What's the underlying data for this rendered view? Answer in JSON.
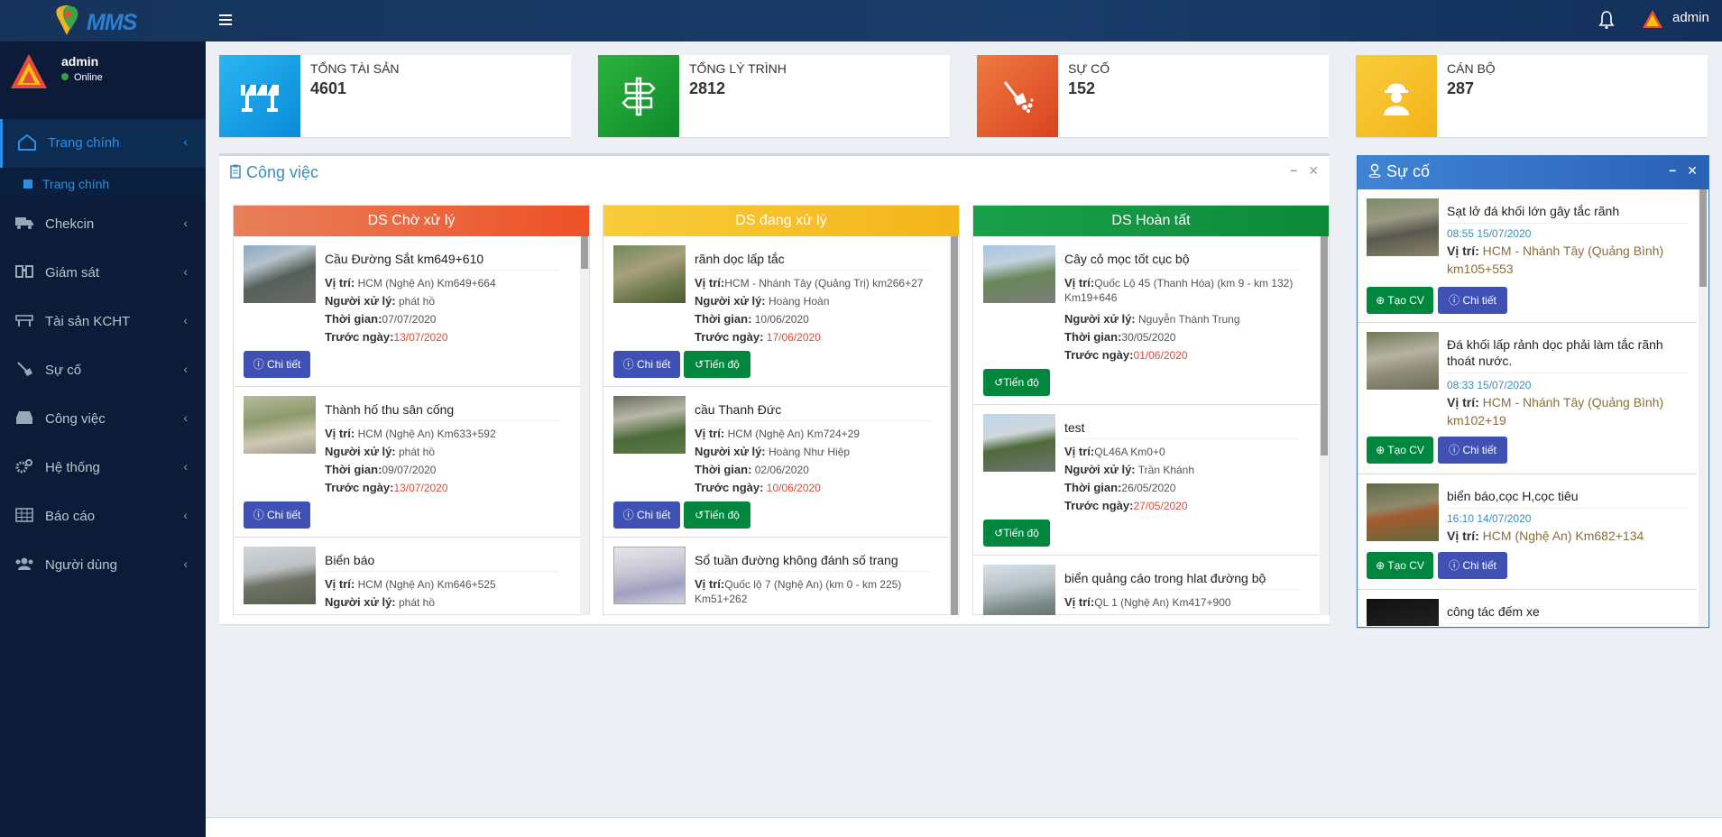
{
  "app": {
    "logo_text": "MMS"
  },
  "topbar": {
    "user": "admin"
  },
  "sidebar": {
    "user_name": "admin",
    "status": "Online",
    "items": [
      {
        "label": "Trang chính",
        "icon": "home-icon"
      },
      {
        "label": "Chekcin",
        "icon": "truck-icon"
      },
      {
        "label": "Giám sát",
        "icon": "binoculars-icon"
      },
      {
        "label": "Tài sản KCHT",
        "icon": "barrier-icon"
      },
      {
        "label": "Sự cố",
        "icon": "shovel-icon"
      },
      {
        "label": "Công việc",
        "icon": "inbox-icon"
      },
      {
        "label": "Hệ thống",
        "icon": "gears-icon"
      },
      {
        "label": "Báo cáo",
        "icon": "table-icon"
      },
      {
        "label": "Người dùng",
        "icon": "users-icon"
      }
    ],
    "subitem": "Trang chính"
  },
  "stats": [
    {
      "label": "TỔNG TÀI SẢN",
      "value": "4601",
      "color": "#0ea5e9"
    },
    {
      "label": "TỔNG LÝ TRÌNH",
      "value": "2812",
      "color": "#1aa32a"
    },
    {
      "label": "SỰ CỐ",
      "value": "152",
      "color": "#e95b2e"
    },
    {
      "label": "CÁN BỘ",
      "value": "287",
      "color": "#f8c02c"
    }
  ],
  "work": {
    "title": "Công việc",
    "labels": {
      "location": "Vị trí:",
      "handler": "Người xử lý:",
      "time": "Thời gian:",
      "due": "Trước ngày:",
      "detail": "Chi tiết",
      "progress": "Tiến độ"
    },
    "columns": [
      {
        "title": "DS Chờ xử lý",
        "items": [
          {
            "title": "Cầu Đường Sắt km649+610",
            "location": "HCM (Nghệ An) Km649+664",
            "handler": "phát hồ",
            "time": "07/07/2020",
            "due": "13/07/2020"
          },
          {
            "title": "Thành hố thu sân cống",
            "location": "HCM (Nghệ An) Km633+592",
            "handler": "phát hồ",
            "time": "09/07/2020",
            "due": "13/07/2020"
          },
          {
            "title": "Biển báo",
            "location": "HCM (Nghệ An) Km646+525",
            "handler": "phát hồ",
            "time": "",
            "due": ""
          }
        ]
      },
      {
        "title": "DS đang xử lý",
        "items": [
          {
            "title": "rãnh dọc lấp tắc",
            "location": "HCM - Nhánh Tây (Quảng Trị) km266+27",
            "handler": "Hoàng Hoàn",
            "time": "10/06/2020",
            "due": "17/06/2020"
          },
          {
            "title": "cầu Thanh Đức",
            "location": "HCM (Nghệ An) Km724+29",
            "handler": "Hoàng Như Hiệp",
            "time": "02/06/2020",
            "due": "10/06/2020"
          },
          {
            "title": "Sổ tuần đường không đánh số trang",
            "location": "Quốc lộ 7 (Nghệ An) (km 0 - km 225) Km51+262",
            "handler": "",
            "time": "",
            "due": ""
          }
        ]
      },
      {
        "title": "DS Hoàn tất",
        "items": [
          {
            "title": "Cây cỏ mọc tốt cục bộ",
            "location": "Quốc Lộ 45 (Thanh Hóa) (km 9 - km 132) Km19+646",
            "handler": "Nguyễn Thành Trung",
            "time": "30/05/2020",
            "due": "01/06/2020"
          },
          {
            "title": "test",
            "location": "QL46A Km0+0",
            "handler": "Trần Khánh",
            "time": "26/05/2020",
            "due": "27/05/2020"
          },
          {
            "title": "biển quảng cáo trong hlat đường bộ",
            "location": "QL 1 (Nghệ An) Km417+900",
            "handler": "",
            "time": "",
            "due": ""
          }
        ]
      }
    ]
  },
  "incidents": {
    "title": "Sự cố",
    "labels": {
      "location": "Vị trí:",
      "create": "Tạo CV",
      "detail": "Chi tiết"
    },
    "items": [
      {
        "title": "Sạt lở đá khối lớn gây tắc rãnh",
        "time": "08:55 15/07/2020",
        "location": "HCM - Nhánh Tây (Quảng Bình) km105+553"
      },
      {
        "title": "Đá khối lấp rảnh dọc phải làm tắc rãnh thoát nước.",
        "time": "08:33 15/07/2020",
        "location": "HCM - Nhánh Tây (Quảng Bình) km102+19"
      },
      {
        "title": "biển báo,cọc H,cọc tiêu",
        "time": "16:10 14/07/2020",
        "location": "HCM (Nghệ An) Km682+134"
      },
      {
        "title": "công tác đếm xe",
        "time": "",
        "location": ""
      }
    ]
  }
}
